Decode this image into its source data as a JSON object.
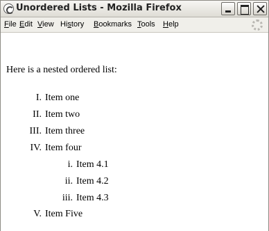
{
  "window": {
    "title": "Unordered Lists - Mozilla Firefox"
  },
  "menu": {
    "file": {
      "u": "F",
      "rest": "ile"
    },
    "edit": {
      "u": "E",
      "rest": "dit"
    },
    "view": {
      "u": "V",
      "rest": "iew"
    },
    "history": {
      "pre": "Hi",
      "u": "s",
      "rest": "tory"
    },
    "bookmarks": {
      "u": "B",
      "rest": "ookmarks"
    },
    "tools": {
      "u": "T",
      "rest": "ools"
    },
    "help": {
      "u": "H",
      "rest": "elp"
    }
  },
  "page": {
    "intro": "Here is a nested ordered list:",
    "outer": [
      {
        "num": "I.",
        "text": "Item one"
      },
      {
        "num": "II.",
        "text": "Item two"
      },
      {
        "num": "III.",
        "text": "Item three"
      },
      {
        "num": "IV.",
        "text": "Item four"
      },
      {
        "num": "V.",
        "text": "Item Five"
      }
    ],
    "inner": [
      {
        "num": "i.",
        "text": "Item 4.1"
      },
      {
        "num": "ii.",
        "text": "Item 4.2"
      },
      {
        "num": "iii.",
        "text": "Item 4.3"
      }
    ]
  }
}
